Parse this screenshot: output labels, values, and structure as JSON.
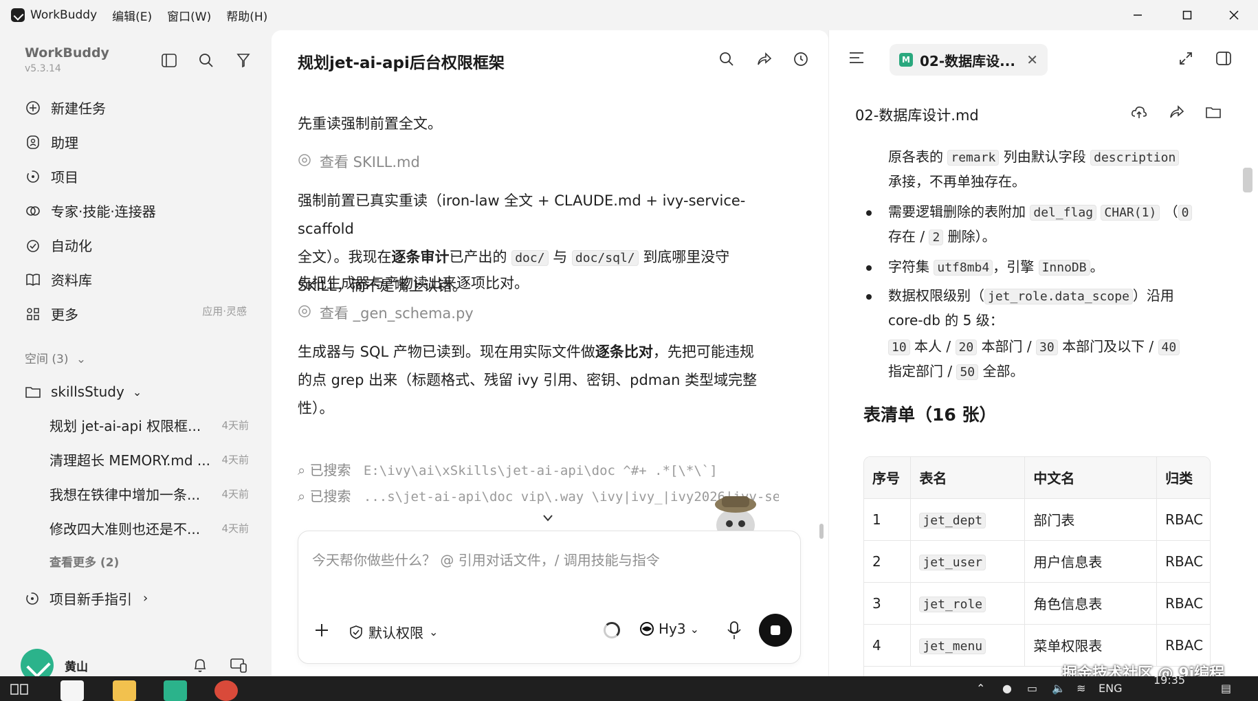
{
  "titlebar": {
    "app_name": "WorkBuddy",
    "menus": [
      "编辑(E)",
      "窗口(W)",
      "帮助(H)"
    ]
  },
  "sidebar": {
    "brand": "WorkBuddy",
    "version": "v5.3.14",
    "nav": [
      {
        "label": "新建任务",
        "icon": "plus-circle-icon"
      },
      {
        "label": "助理",
        "icon": "assistant-icon"
      },
      {
        "label": "项目",
        "icon": "project-icon"
      },
      {
        "label": "专家·技能·连接器",
        "icon": "expert-icon"
      },
      {
        "label": "自动化",
        "icon": "automation-icon"
      },
      {
        "label": "资料库",
        "icon": "book-icon"
      },
      {
        "label": "更多",
        "icon": "grid-icon",
        "aside": "应用·灵感"
      }
    ],
    "spaces_label": "空间 (3)",
    "folder": "skillsStudy",
    "tasks": [
      {
        "title": "规划 jet-ai-api 权限框...",
        "time": "4天前"
      },
      {
        "title": "清理超长 MEMORY.md ...",
        "time": "4天前"
      },
      {
        "title": "我想在铁律中增加一条...",
        "time": "4天前"
      },
      {
        "title": "修改四大准则也还是不...",
        "time": "4天前"
      }
    ],
    "see_more": "查看更多 (2)",
    "guide": "项目新手指引",
    "user": "黄山"
  },
  "chat": {
    "title": "规划jet-ai-api后台权限框架",
    "p1": "先重读强制前置全文。",
    "tool1": "查看 SKILL.md",
    "p2_a": "强制前置已真实重读（iron-law 全文 + CLAUDE.md + ivy-service-scaffold",
    "p2_b": "全文）。我现在",
    "p2_bold": "逐条审计",
    "p2_c": "已产出的",
    "p2_code1": "doc/",
    "p2_d": "与",
    "p2_code2": "doc/sql/",
    "p2_e": "到底哪里没守",
    "p2_f": "SKILL，而不是嘴上认错。",
    "p3": "先把生成器与产物读出来逐项比对。",
    "tool2": "查看 _gen_schema.py",
    "p4_a": "生成器与 SQL 产物已读到。现在用实际文件做",
    "p4_bold": "逐条比对",
    "p4_b": "，先把可能违规",
    "p4_c": "的点 grep 出来（标题格式、残留 ivy 引用、密钥、pdman 类型域完整",
    "p4_d": "性）。",
    "search1_label": "已搜索",
    "search1_path": "E:\\ivy\\ai\\xSkills\\jet-ai-api\\doc  ^#+ .*[\\*\\`]",
    "search2_label": "已搜索",
    "search2_path": "...s\\jet-ai-api\\doc  vip\\.way  \\ivy|ivy_|ivy2026|ivy-se...",
    "input_placeholder": "今天帮你做些什么？ @ 引用对话文件，/ 调用技能与指令",
    "permission": "默认权限",
    "model": "Hy3"
  },
  "doc": {
    "tab_title": "02-数据库设...",
    "file_name": "02-数据库设计.md",
    "lines": {
      "l1_a": "原各表的",
      "l1_code1": "remark",
      "l1_b": "列由默认字段",
      "l1_code2": "description",
      "l2": "承接，不再单独存在。",
      "l3_a": "需要逻辑删除的表附加",
      "l3_code1": "del_flag",
      "l3_code2": "CHAR(1)",
      "l3_b": "（",
      "l3_code3": "0",
      "l4_a": "存在 /",
      "l4_code": "2",
      "l4_b": "删除）。",
      "l5_a": "字符集",
      "l5_code1": "utf8mb4",
      "l5_b": "，引擎",
      "l5_code2": "InnoDB",
      "l5_c": "。",
      "l6_a": "数据权限级别（",
      "l6_code": "jet_role.data_scope",
      "l6_b": "）沿用",
      "l7": "core-db 的 5 级：",
      "l8": [
        {
          "code": "10",
          "text": "本人 /"
        },
        {
          "code": "20",
          "text": "本部门 /"
        },
        {
          "code": "30",
          "text": "本部门及以下 /"
        },
        {
          "code": "40",
          "text": ""
        }
      ],
      "l9_a": "指定部门 /",
      "l9_code": "50",
      "l9_b": "全部。"
    },
    "heading": "表清单（16 张）",
    "table": {
      "headers": [
        "序号",
        "表名",
        "中文名",
        "归类"
      ],
      "rows": [
        [
          "1",
          "jet_dept",
          "部门表",
          "RBAC"
        ],
        [
          "2",
          "jet_user",
          "用户信息表",
          "RBAC"
        ],
        [
          "3",
          "jet_role",
          "角色信息表",
          "RBAC"
        ],
        [
          "4",
          "jet_menu",
          "菜单权限表",
          "RBAC"
        ]
      ]
    }
  },
  "watermark": "掘金技术社区 @ 9i编程",
  "taskbar": {
    "lang": "ENG",
    "time": "19:35"
  },
  "colors": {
    "accent": "#2bb38b",
    "sidebar_bg": "#f3f3f3",
    "panel_bg": "#ffffff"
  }
}
